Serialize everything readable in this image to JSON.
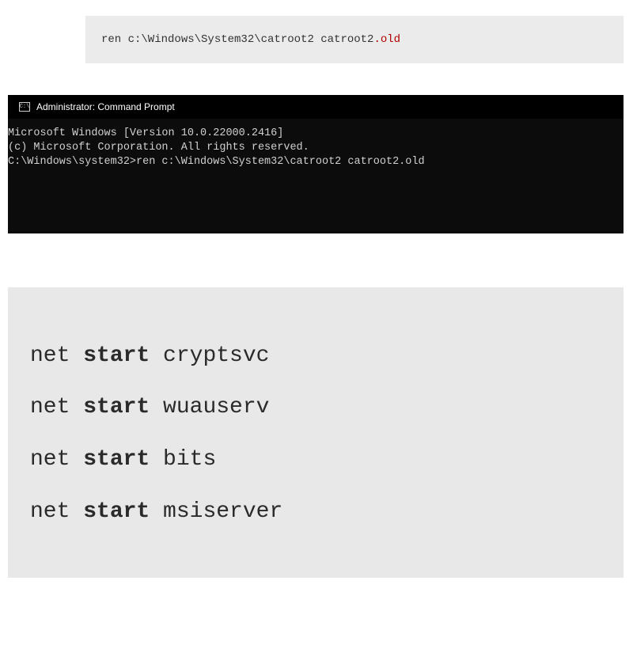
{
  "codeBlock1": {
    "prefix": "ren c:\\Windows\\System32\\catroot2 catroot2",
    "dot": ".",
    "suffix": "old"
  },
  "terminal": {
    "titleIconLabel": "C:\\",
    "title": "Administrator: Command Prompt",
    "lines": {
      "l1": "Microsoft Windows [Version 10.0.22000.2416]",
      "l2": "(c) Microsoft Corporation. All rights reserved.",
      "l3": "",
      "l4": "C:\\Windows\\system32>ren c:\\Windows\\System32\\catroot2 catroot2.old"
    }
  },
  "codeBlock2": {
    "rows": [
      {
        "cmd": "net ",
        "kw": "start",
        "arg": " cryptsvc"
      },
      {
        "cmd": "net ",
        "kw": "start",
        "arg": " wuauserv"
      },
      {
        "cmd": "net ",
        "kw": "start",
        "arg": " bits"
      },
      {
        "cmd": "net ",
        "kw": "start",
        "arg": " msiserver"
      }
    ]
  }
}
